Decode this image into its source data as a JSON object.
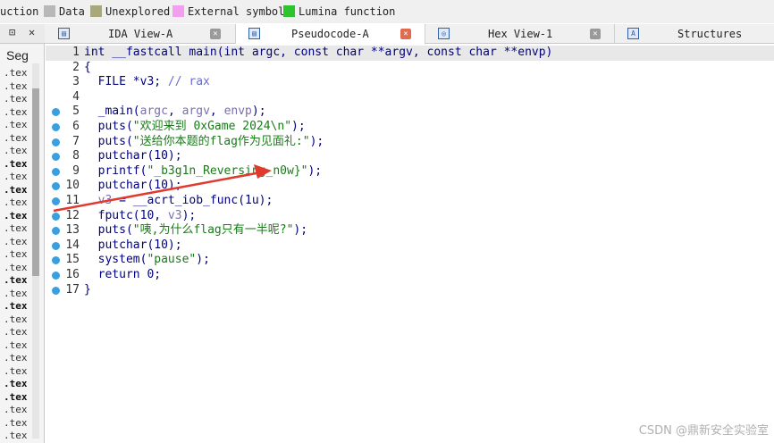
{
  "legend": {
    "items": [
      {
        "label": "uction",
        "color": ""
      },
      {
        "label": "Data",
        "color": "#b8b8b8"
      },
      {
        "label": "Unexplored",
        "color": "#a8a878"
      },
      {
        "label": "External symbol",
        "color": "#f29ff0"
      },
      {
        "label": "Lumina function",
        "color": "#2fc42f"
      }
    ]
  },
  "left_panel": {
    "pin_icon": "pin-icon",
    "close_icon": "close-icon",
    "title": "Seg",
    "rows": [
      ".tex",
      ".tex",
      ".tex",
      ".tex",
      ".tex",
      ".tex",
      ".tex",
      ".tex",
      ".tex",
      ".tex",
      ".tex",
      ".tex",
      ".tex",
      ".tex",
      ".tex",
      ".tex",
      ".tex",
      ".tex",
      ".tex",
      ".tex",
      ".tex",
      ".tex",
      ".tex",
      ".tex",
      ".tex",
      ".tex",
      ".tex",
      ".tex",
      ".tex",
      ".tex"
    ]
  },
  "tabs": [
    {
      "label": "IDA View-A",
      "icon": "ida-view-icon",
      "active": false
    },
    {
      "label": "Pseudocode-A",
      "icon": "pseudocode-icon",
      "active": true
    },
    {
      "label": "Hex View-1",
      "icon": "hex-view-icon",
      "active": false
    },
    {
      "label": "Structures",
      "icon": "structures-icon",
      "active": false
    }
  ],
  "code": {
    "lines": [
      {
        "n": "1",
        "dot": false,
        "parts": [
          {
            "t": "int __fastcall main(int argc, const char **argv, const char **envp)",
            "c": ""
          }
        ]
      },
      {
        "n": "2",
        "dot": false,
        "parts": [
          {
            "t": "{",
            "c": ""
          }
        ]
      },
      {
        "n": "3",
        "dot": false,
        "parts": [
          {
            "t": "  FILE *v3; ",
            "c": ""
          },
          {
            "t": "// rax",
            "c": "cmt"
          }
        ]
      },
      {
        "n": "4",
        "dot": false,
        "parts": [
          {
            "t": "",
            "c": ""
          }
        ]
      },
      {
        "n": "5",
        "dot": true,
        "parts": [
          {
            "t": "  _main(",
            "c": ""
          },
          {
            "t": "argc",
            "c": "var"
          },
          {
            "t": ", ",
            "c": ""
          },
          {
            "t": "argv",
            "c": "var"
          },
          {
            "t": ", ",
            "c": ""
          },
          {
            "t": "envp",
            "c": "var"
          },
          {
            "t": ");",
            "c": ""
          }
        ]
      },
      {
        "n": "6",
        "dot": true,
        "parts": [
          {
            "t": "  puts(",
            "c": ""
          },
          {
            "t": "\"欢迎来到 0xGame 2024\\n\"",
            "c": "str"
          },
          {
            "t": ");",
            "c": ""
          }
        ]
      },
      {
        "n": "7",
        "dot": true,
        "parts": [
          {
            "t": "  puts(",
            "c": ""
          },
          {
            "t": "\"送给你本题的flag作为见面礼:\"",
            "c": "str"
          },
          {
            "t": ");",
            "c": ""
          }
        ]
      },
      {
        "n": "8",
        "dot": true,
        "parts": [
          {
            "t": "  putchar(10);",
            "c": ""
          }
        ]
      },
      {
        "n": "9",
        "dot": true,
        "parts": [
          {
            "t": "  printf(",
            "c": ""
          },
          {
            "t": "\"_b3g1n_Reversing_n0w}\"",
            "c": "str"
          },
          {
            "t": ");",
            "c": ""
          }
        ]
      },
      {
        "n": "10",
        "dot": true,
        "parts": [
          {
            "t": "  putchar(10);",
            "c": ""
          }
        ]
      },
      {
        "n": "11",
        "dot": true,
        "parts": [
          {
            "t": "  ",
            "c": ""
          },
          {
            "t": "v3",
            "c": "var"
          },
          {
            "t": " = __acrt_iob_func(1u);",
            "c": ""
          }
        ]
      },
      {
        "n": "12",
        "dot": true,
        "parts": [
          {
            "t": "  fputc(10, ",
            "c": ""
          },
          {
            "t": "v3",
            "c": "var"
          },
          {
            "t": ");",
            "c": ""
          }
        ]
      },
      {
        "n": "13",
        "dot": true,
        "parts": [
          {
            "t": "  puts(",
            "c": ""
          },
          {
            "t": "\"咦,为什么flag只有一半呢?\"",
            "c": "str"
          },
          {
            "t": ");",
            "c": ""
          }
        ]
      },
      {
        "n": "14",
        "dot": true,
        "parts": [
          {
            "t": "  putchar(10);",
            "c": ""
          }
        ]
      },
      {
        "n": "15",
        "dot": true,
        "parts": [
          {
            "t": "  system(",
            "c": ""
          },
          {
            "t": "\"pause\"",
            "c": "str"
          },
          {
            "t": ");",
            "c": ""
          }
        ]
      },
      {
        "n": "16",
        "dot": true,
        "parts": [
          {
            "t": "  return 0;",
            "c": ""
          }
        ]
      },
      {
        "n": "17",
        "dot": true,
        "parts": [
          {
            "t": "}",
            "c": ""
          }
        ]
      }
    ]
  },
  "watermark": "CSDN @鼎新安全实验室",
  "colors": {
    "code_text": "#000080",
    "variable": "#7b6fb0",
    "string": "#1a7a1a",
    "comment": "#6b6bd1",
    "breakpoint_dot": "#3a9fe0",
    "annotation_arrow": "#e03a2f"
  }
}
